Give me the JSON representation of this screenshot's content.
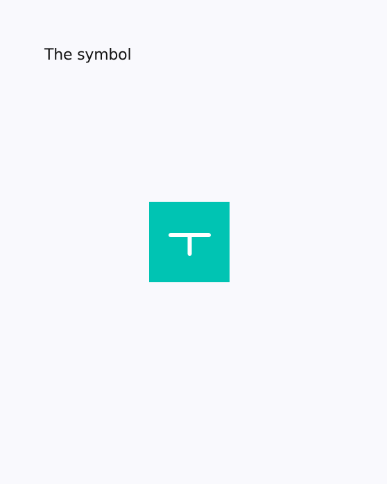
{
  "heading": {
    "text": "The symbol"
  },
  "symbol": {
    "icon": "t-letter-icon",
    "background_color": "#00c4b3",
    "glyph_color": "#ffffff"
  },
  "page": {
    "background_color": "#f9f9fd"
  }
}
